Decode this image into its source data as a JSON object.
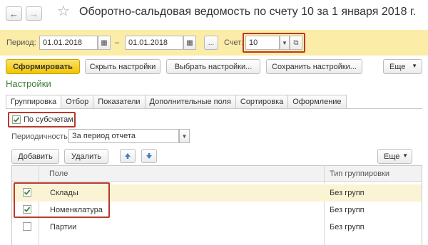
{
  "window": {
    "title": "Оборотно-сальдовая ведомость по счету 10 за 1 января 2018 г."
  },
  "period": {
    "label": "Период:",
    "from": "01.01.2018",
    "dash": "–",
    "to": "01.01.2018",
    "more": "...",
    "account_label": "Счет:",
    "account_value": "10"
  },
  "commands": {
    "generate": "Сформировать",
    "hide_settings": "Скрыть настройки",
    "choose_settings": "Выбрать настройки...",
    "save_settings": "Сохранить настройки...",
    "more": "Еще"
  },
  "settings": {
    "title": "Настройки",
    "tabs": [
      "Группировка",
      "Отбор",
      "Показатели",
      "Дополнительные поля",
      "Сортировка",
      "Оформление"
    ],
    "by_subaccounts": "По субсчетам",
    "periodicity_label": "Периодичность:",
    "periodicity_value": "За период отчета",
    "add": "Добавить",
    "delete": "Удалить",
    "more": "Еще"
  },
  "table": {
    "columns": [
      "Поле",
      "Тип группировки"
    ],
    "rows": [
      {
        "checked": true,
        "field": "Склады",
        "type": "Без групп"
      },
      {
        "checked": true,
        "field": "Номенклатура",
        "type": "Без групп"
      },
      {
        "checked": false,
        "field": "Партии",
        "type": "Без групп"
      }
    ]
  },
  "colors": {
    "panel": "#fbeca8",
    "primary": "#f2c500",
    "highlight": "#b83a2c",
    "section": "#3a7f3a",
    "check": "#3a8a3a",
    "arrow": "#3f7fc8"
  }
}
